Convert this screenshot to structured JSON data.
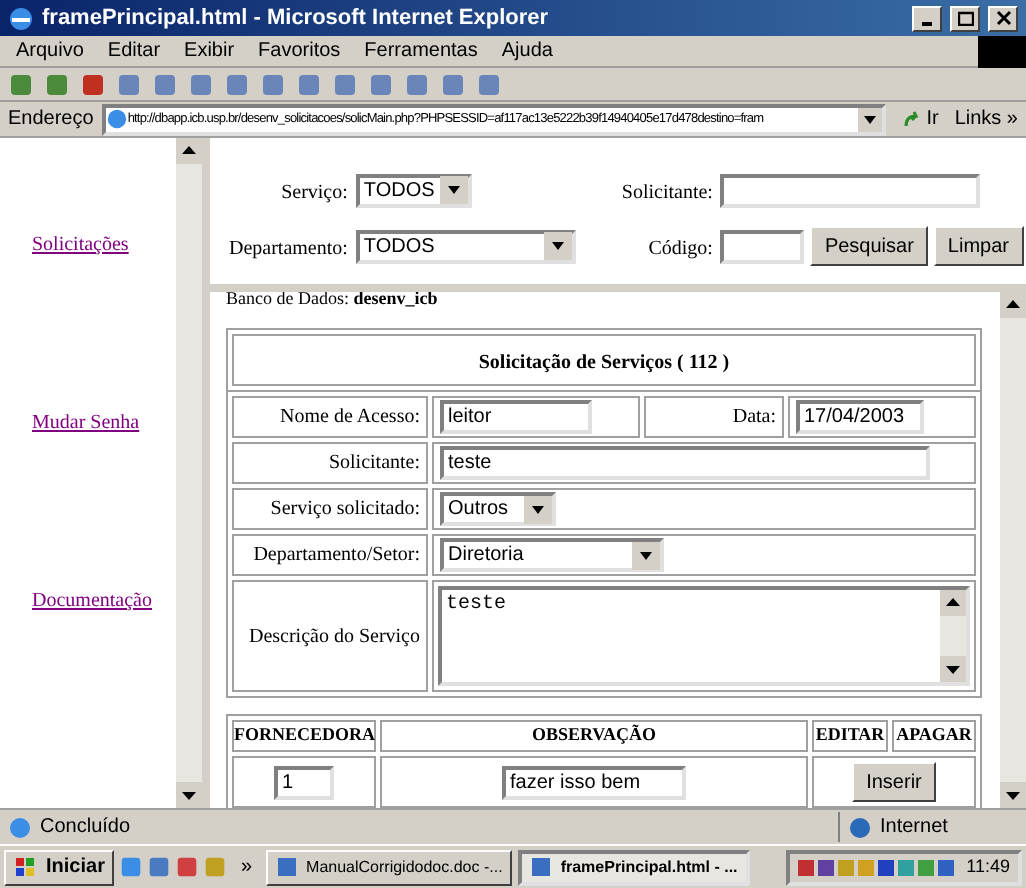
{
  "window": {
    "title": "framePrincipal.html - Microsoft Internet Explorer"
  },
  "menu": [
    "Arquivo",
    "Editar",
    "Exibir",
    "Favoritos",
    "Ferramentas",
    "Ajuda"
  ],
  "address_bar": {
    "label": "Endereço",
    "url": "http://dbapp.icb.usp.br/desenv_solicitacoes/solicMain.php?PHPSESSID=af117ac13e5222b39f14940405e17d478destino=fram",
    "go": "Ir",
    "links": "Links »"
  },
  "sidebar": {
    "links": [
      "Solicitações",
      "Mudar Senha",
      "Documentação"
    ]
  },
  "filter": {
    "servico_label": "Serviço:",
    "servico": "TODOS",
    "solicitante_label": "Solicitante:",
    "departamento_label": "Departamento:",
    "departamento": "TODOS",
    "codigo_label": "Código:",
    "buttons": [
      "Pesquisar",
      "Limpar"
    ]
  },
  "database": {
    "label": "Banco de Dados:",
    "name": "desenv_icb"
  },
  "form": {
    "title": "Solicitação de Serviços ( 112 )",
    "nome_label": "Nome de Acesso:",
    "nome": "leitor",
    "data_label": "Data:",
    "data": "17/04/2003",
    "solicitante_label": "Solicitante:",
    "solicitante": "teste",
    "servico_label": "Serviço solicitado:",
    "servico": "Outros",
    "departamento_label": "Departamento/Setor:",
    "departamento": "Diretoria",
    "descricao_label": "Descrição do Serviço",
    "descricao": "teste"
  },
  "suppliers": {
    "columns": [
      "FORNECEDORA",
      "OBSERVAÇÃO",
      "EDITAR",
      "APAGAR"
    ],
    "fornecedora": "1",
    "observacao": "fazer isso bem",
    "button": "Inserir"
  },
  "status_bar": {
    "text": "Concluído",
    "zone": "Internet"
  },
  "taskbar": {
    "start": "Iniciar",
    "chevron": "»",
    "tasks": [
      {
        "label": "ManualCorrigidodoc.doc -...",
        "selected": false
      },
      {
        "label": "framePrincipal.html - ...",
        "selected": true
      }
    ],
    "clock": "11:49"
  }
}
